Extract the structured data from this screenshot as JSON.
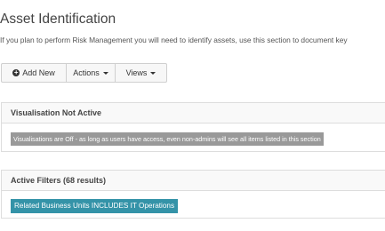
{
  "page": {
    "title": "Asset Identification",
    "description": "If you plan to perform Risk Management you will need to identify assets, use this section to document key"
  },
  "toolbar": {
    "add_new_label": "Add New",
    "actions_label": "Actions",
    "views_label": "Views"
  },
  "visualisation_panel": {
    "title": "Visualisation Not Active",
    "message": "Visualisations are Off - as long as users have access, even non-admins will see all items listed in this section"
  },
  "filters_panel": {
    "title": "Active Filters (68 results)",
    "filter_label": "Related Business Units INCLUDES IT Operations"
  },
  "colors": {
    "filter_badge": "#3493a8",
    "info_badge": "#999999",
    "panel_header_bg": "#f9f9f9"
  },
  "icons": {
    "add": "plus-circle-icon",
    "dropdown": "caret-down-icon"
  }
}
